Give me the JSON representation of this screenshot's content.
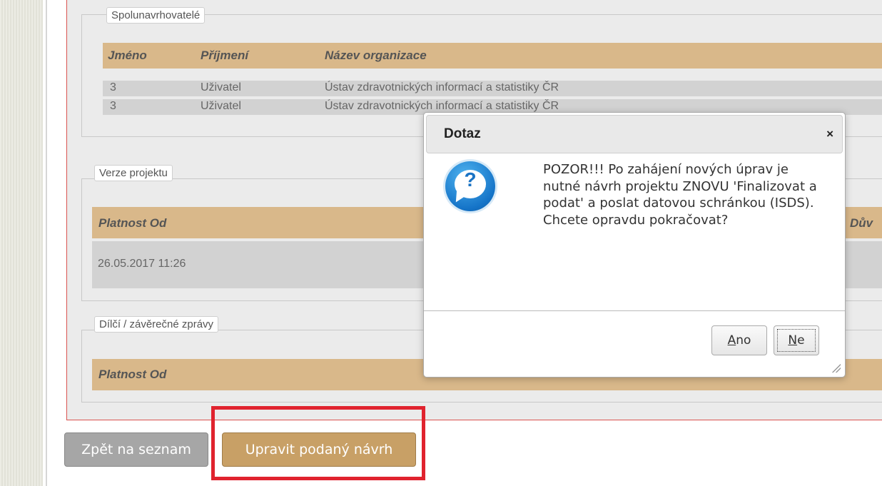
{
  "sections": {
    "co_applicants": {
      "legend": "Spolunavrhovatelé",
      "headers": [
        "Jméno",
        "Příjmení",
        "Název organizace"
      ],
      "rows": [
        [
          "3",
          "Uživatel",
          "Ústav zdravotnických informací a statistiky ČR"
        ],
        [
          "3",
          "Uživatel",
          "Ústav zdravotnických informací a statistiky ČR"
        ]
      ]
    },
    "project_versions": {
      "legend": "Verze projektu",
      "header_left": "Platnost Od",
      "header_right": "Dův",
      "row_value": "26.05.2017 11:26"
    },
    "reports": {
      "legend": "Dílčí / závěrečné zprávy",
      "header_left": "Platnost Od"
    }
  },
  "buttons": {
    "back": "Zpět na seznam",
    "edit": "Upravit podaný návrh"
  },
  "dialog": {
    "title": "Dotaz",
    "close": "×",
    "icon_glyph": "?",
    "message": "POZOR!!! Po zahájení nových úprav je nutné návrh projektu ZNOVU 'Finalizovat a podat' a poslat datovou schránkou (ISDS). Chcete opravdu pokračovat?",
    "yes_accel": "A",
    "yes_rest": "no",
    "no_accel": "N",
    "no_rest": "e"
  },
  "colors": {
    "header_tan": "#d9b88a",
    "edit_button": "#c8a066",
    "highlight_red": "#e0232e"
  }
}
